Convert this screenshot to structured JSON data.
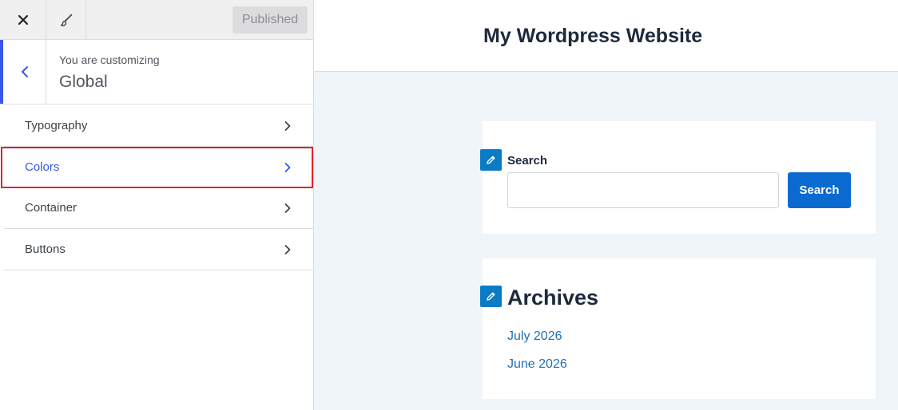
{
  "topbar": {
    "close_icon": "close-icon",
    "brush_icon": "paintbrush-icon",
    "publish_label": "Published"
  },
  "section": {
    "customizing_label": "You are customizing",
    "title": "Global",
    "back_icon": "chevron-left-icon"
  },
  "menu": {
    "items": [
      {
        "label": "Typography"
      },
      {
        "label": "Colors"
      },
      {
        "label": "Container"
      },
      {
        "label": "Buttons"
      }
    ]
  },
  "preview": {
    "site_title": "My Wordpress Website",
    "search_widget": {
      "label": "Search",
      "input_value": "",
      "button_label": "Search"
    },
    "archives_widget": {
      "title": "Archives",
      "links": [
        "July 2026",
        "June 2026"
      ]
    }
  },
  "colors": {
    "accent": "#3858e9",
    "highlight_outline": "#e0222b",
    "search_button": "#0a6ad0",
    "edit_shortcut": "#0a7bc4",
    "link": "#1f6fb5"
  }
}
